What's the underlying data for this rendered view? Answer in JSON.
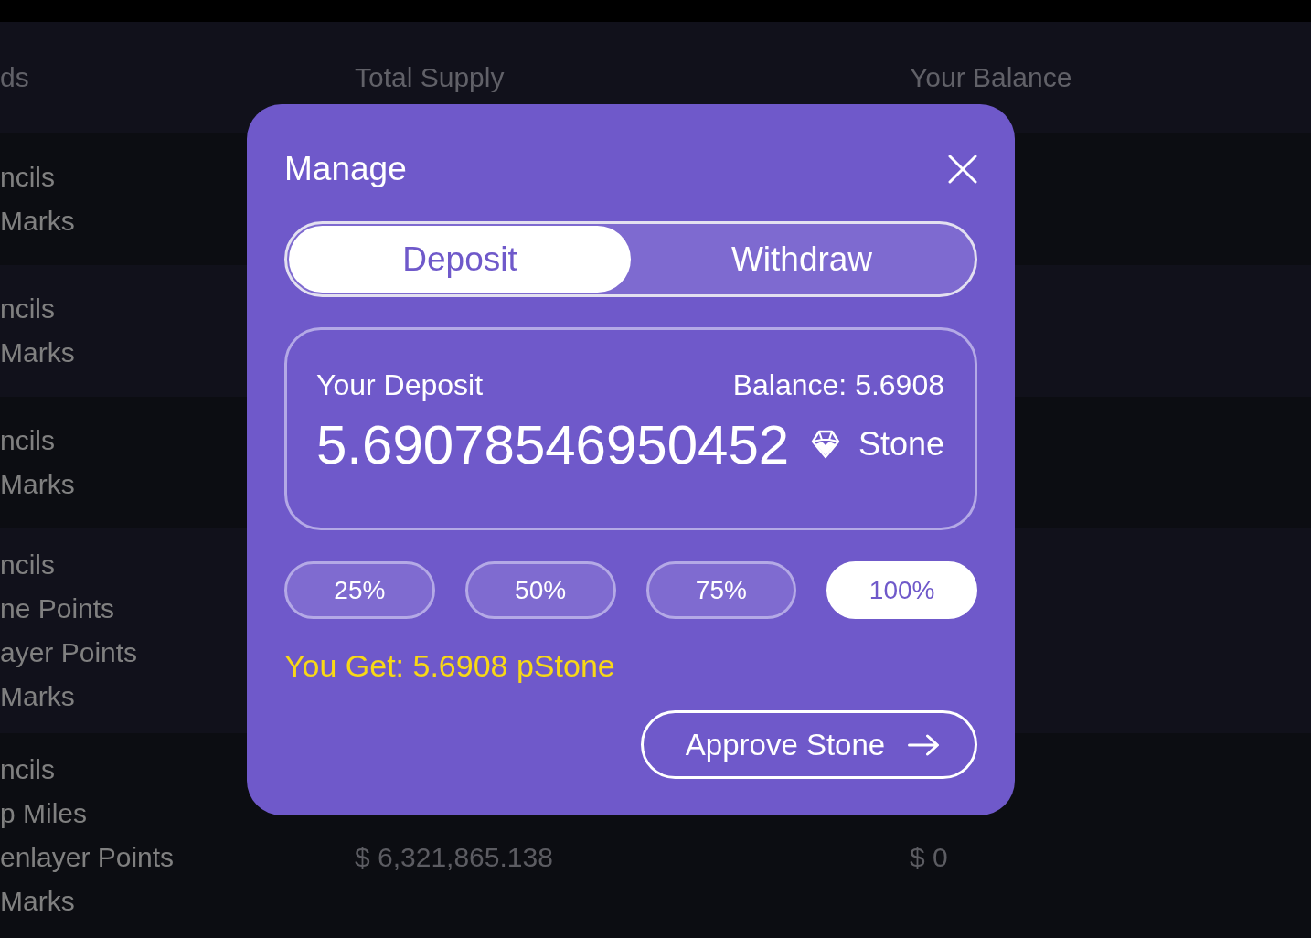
{
  "table": {
    "columns": [
      "ds",
      "Total Supply",
      "Your Balance"
    ],
    "rows": [
      {
        "column_1": [
          "ncils",
          "Marks"
        ]
      },
      {
        "column_1": [
          "ncils",
          "Marks"
        ]
      },
      {
        "column_1": [
          "ncils",
          "Marks"
        ]
      },
      {
        "column_1": [
          "ncils",
          "ne Points",
          "ayer Points",
          "Marks"
        ]
      },
      {
        "column_1": [
          "ncils",
          "p Miles",
          "enlayer Points",
          "Marks"
        ],
        "total_supply": "$ 6,321,865.138",
        "your_balance": "$ 0"
      }
    ]
  },
  "modal": {
    "title": "Manage",
    "tabs": [
      {
        "label": "Deposit",
        "selected": true
      },
      {
        "label": "Withdraw",
        "selected": false
      }
    ],
    "deposit_card": {
      "label": "Your Deposit",
      "balance": "Balance: 5.6908",
      "amount": "5.69078546950452",
      "token": "Stone"
    },
    "percent_buttons": [
      {
        "label": "25%",
        "selected": false
      },
      {
        "label": "50%",
        "selected": false
      },
      {
        "label": "75%",
        "selected": false
      },
      {
        "label": "100%",
        "selected": true
      }
    ],
    "you_get": "You Get: 5.6908 pStone",
    "action_button": "Approve Stone"
  }
}
